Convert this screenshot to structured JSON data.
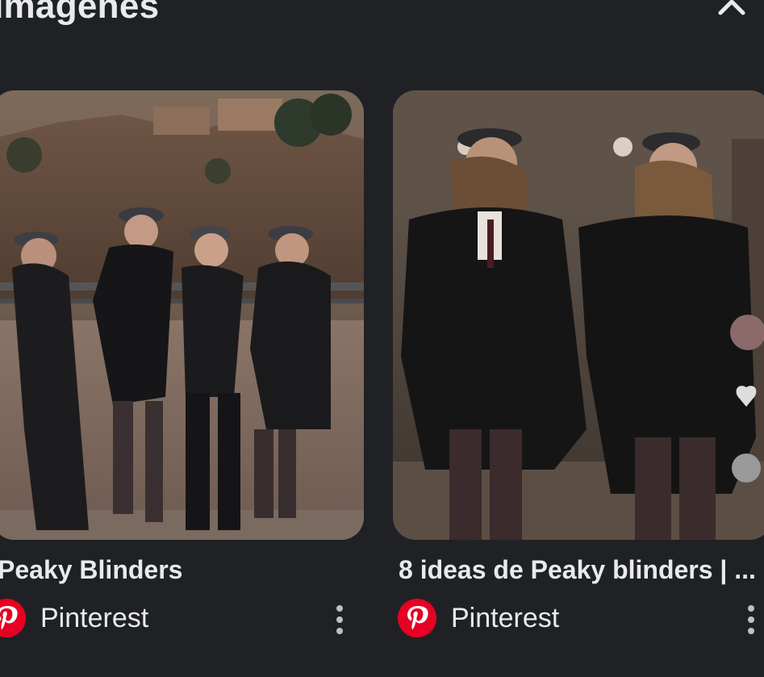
{
  "section": {
    "title": "Imágenes",
    "collapse_icon": "chevron-up-icon"
  },
  "results": [
    {
      "title": "Peaky Blinders",
      "source": "Pinterest",
      "logo_icon": "pinterest-logo-icon",
      "more_icon": "more-vert-icon"
    },
    {
      "title": "8 ideas de Peaky blinders | ...",
      "source": "Pinterest",
      "logo_icon": "pinterest-logo-icon",
      "more_icon": "more-vert-icon"
    }
  ],
  "colors": {
    "background": "#202124",
    "text": "#e8eaed",
    "pinterest_red": "#e60023"
  }
}
